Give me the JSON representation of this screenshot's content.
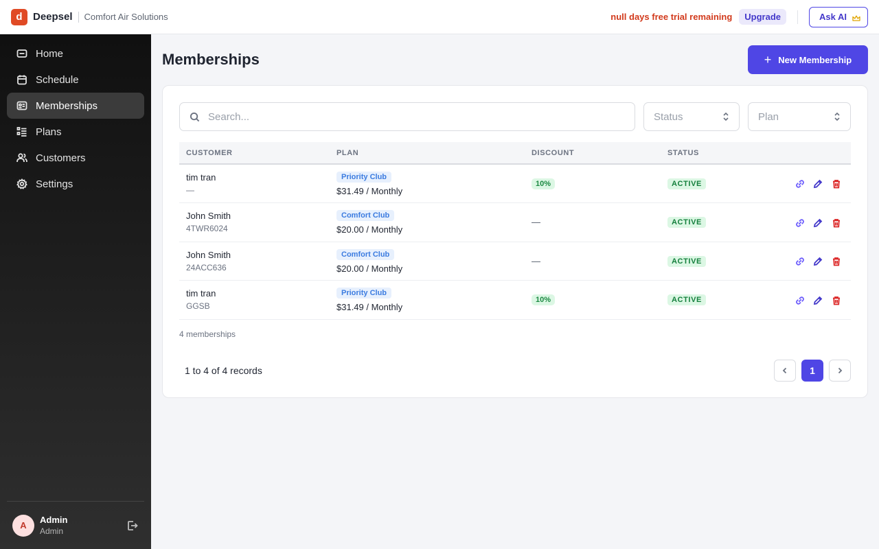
{
  "header": {
    "logo_letter": "d",
    "brand": "Deepsel",
    "company": "Comfort Air Solutions",
    "trial_text": "null days free trial remaining",
    "upgrade_label": "Upgrade",
    "ask_ai_label": "Ask AI"
  },
  "sidebar": {
    "items": [
      {
        "label": "Home",
        "icon": "home-icon"
      },
      {
        "label": "Schedule",
        "icon": "calendar-icon"
      },
      {
        "label": "Memberships",
        "icon": "membership-card-icon",
        "active": true
      },
      {
        "label": "Plans",
        "icon": "list-icon"
      },
      {
        "label": "Customers",
        "icon": "users-icon"
      },
      {
        "label": "Settings",
        "icon": "gear-icon"
      }
    ],
    "user": {
      "initial": "A",
      "name": "Admin",
      "role": "Admin"
    }
  },
  "main": {
    "title": "Memberships",
    "new_button_label": "New Membership",
    "search_placeholder": "Search...",
    "status_placeholder": "Status",
    "plan_placeholder": "Plan",
    "columns": [
      "CUSTOMER",
      "PLAN",
      "DISCOUNT",
      "STATUS"
    ],
    "rows": [
      {
        "name": "tim tran",
        "sub": "—",
        "plan": "Priority Club",
        "price": "$31.49 / Monthly",
        "discount": "10%",
        "status": "ACTIVE"
      },
      {
        "name": "John Smith",
        "sub": "4TWR6024",
        "plan": "Comfort Club",
        "price": "$20.00 / Monthly",
        "discount": "—",
        "status": "ACTIVE"
      },
      {
        "name": "John Smith",
        "sub": "24ACC636",
        "plan": "Comfort Club",
        "price": "$20.00 / Monthly",
        "discount": "—",
        "status": "ACTIVE"
      },
      {
        "name": "tim tran",
        "sub": "GGSB",
        "plan": "Priority Club",
        "price": "$31.49 / Monthly",
        "discount": "10%",
        "status": "ACTIVE"
      }
    ],
    "count_text": "4 memberships",
    "records_text": "1 to 4 of 4 records",
    "current_page": "1"
  },
  "colors": {
    "accent": "#4f46e5",
    "brand": "#e04a25",
    "trial": "#d23a1c",
    "active_bg": "#dcf7e4",
    "active_text": "#15803d"
  }
}
